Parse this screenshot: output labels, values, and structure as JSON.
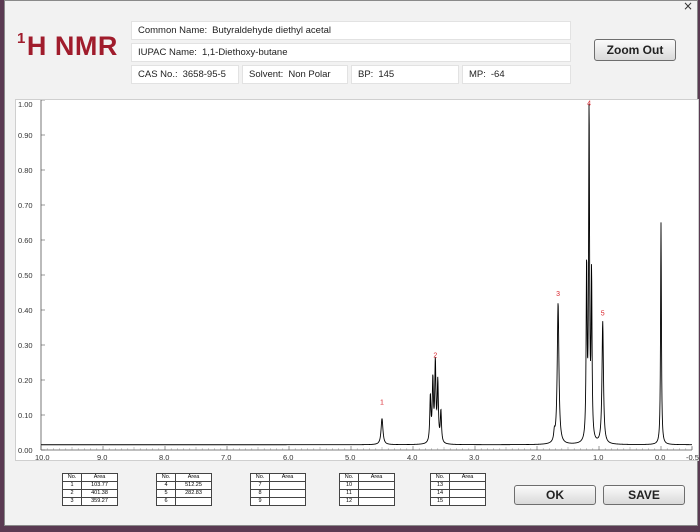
{
  "window": {
    "close_glyph": "×"
  },
  "header": {
    "title_sup": "1",
    "title_main": "H NMR",
    "common_name_label": "Common Name:",
    "common_name": "Butyraldehyde diethyl acetal",
    "iupac_label": "IUPAC Name:",
    "iupac_name": "1,1-Diethoxy-butane",
    "cas_label": "CAS No.:",
    "cas": "3658-95-5",
    "solvent_label": "Solvent:",
    "solvent": "Non Polar",
    "bp_label": "BP:",
    "bp": "145",
    "mp_label": "MP:",
    "mp": "-64"
  },
  "buttons": {
    "zoom_out": "Zoom Out",
    "ok": "OK",
    "save": "SAVE"
  },
  "tables": {
    "header_no": "No.",
    "header_area": "Area",
    "groups": [
      [
        {
          "no": "1",
          "area": "103.77"
        },
        {
          "no": "2",
          "area": "401.38"
        },
        {
          "no": "3",
          "area": "359.27"
        }
      ],
      [
        {
          "no": "4",
          "area": "512.25"
        },
        {
          "no": "5",
          "area": "282.83"
        },
        {
          "no": "6",
          "area": ""
        }
      ],
      [
        {
          "no": "7",
          "area": ""
        },
        {
          "no": "8",
          "area": ""
        },
        {
          "no": "9",
          "area": ""
        }
      ],
      [
        {
          "no": "10",
          "area": ""
        },
        {
          "no": "11",
          "area": ""
        },
        {
          "no": "12",
          "area": ""
        }
      ],
      [
        {
          "no": "13",
          "area": ""
        },
        {
          "no": "14",
          "area": ""
        },
        {
          "no": "15",
          "area": ""
        }
      ]
    ]
  },
  "chart_data": {
    "type": "line",
    "xlim": [
      10.0,
      -0.5
    ],
    "ylim": [
      0.0,
      1.0
    ],
    "x_reversed": true,
    "yticks": [
      "0.00",
      "0.10",
      "0.20",
      "0.30",
      "0.40",
      "0.50",
      "0.60",
      "0.70",
      "0.80",
      "0.90",
      "1.00"
    ],
    "xticks": [
      "10.0",
      "9.0",
      "8.0",
      "7.0",
      "6.0",
      "5.0",
      "4.0",
      "3.0",
      "2.0",
      "1.0",
      "0.0",
      "-0.5"
    ],
    "baseline": 0.015,
    "line_color": "#000000",
    "label_color": "#d9262e",
    "peaks": [
      {
        "x": 4.5,
        "h": 0.075,
        "w": 0.018
      },
      {
        "x": 3.72,
        "h": 0.13,
        "w": 0.011
      },
      {
        "x": 3.68,
        "h": 0.175,
        "w": 0.011
      },
      {
        "x": 3.64,
        "h": 0.225,
        "w": 0.011
      },
      {
        "x": 3.6,
        "h": 0.17,
        "w": 0.011
      },
      {
        "x": 3.55,
        "h": 0.09,
        "w": 0.011
      },
      {
        "x": 1.72,
        "h": 0.025,
        "w": 0.012
      },
      {
        "x": 1.66,
        "h": 0.405,
        "w": 0.016
      },
      {
        "x": 1.2,
        "h": 0.495,
        "w": 0.009
      },
      {
        "x": 1.16,
        "h": 0.945,
        "w": 0.009
      },
      {
        "x": 1.12,
        "h": 0.465,
        "w": 0.009
      },
      {
        "x": 0.94,
        "h": 0.35,
        "w": 0.014
      },
      {
        "x": 0.0,
        "h": 0.635,
        "w": 0.008
      }
    ],
    "peak_labels": [
      {
        "text": "1",
        "x": 4.5,
        "y": 0.13
      },
      {
        "text": "2",
        "x": 3.64,
        "y": 0.265
      },
      {
        "text": "3",
        "x": 1.66,
        "y": 0.44
      },
      {
        "text": "4",
        "x": 1.16,
        "y": 0.985
      },
      {
        "text": "5",
        "x": 0.94,
        "y": 0.385
      }
    ]
  }
}
